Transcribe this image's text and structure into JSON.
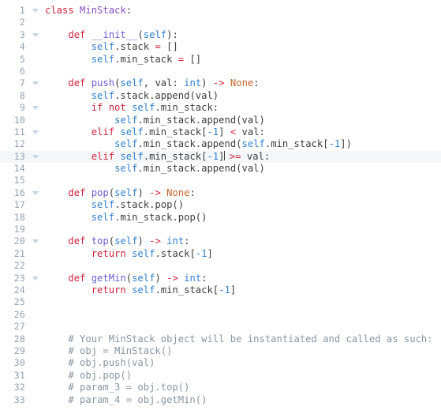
{
  "editor": {
    "language": "python",
    "current_line": 13,
    "colors": {
      "background": "#ffffff",
      "current_line_highlight": "#f4f7fa",
      "gutter_text": "#93a1b0",
      "fold_arrow": "#c3d4e2",
      "keyword": "#d0233c",
      "class_name": "#8a4fc4",
      "function_name": "#6a60d8",
      "self_builtin": "#2f7fd0",
      "none_literal": "#c4642a",
      "number": "#2f7fd0",
      "comment": "#8795a3",
      "plain_text": "#3c3c3c"
    },
    "lines": [
      {
        "number": "1",
        "fold": true,
        "tokens": [
          {
            "t": "class ",
            "c": "t-kw"
          },
          {
            "t": "MinStack",
            "c": "t-cls"
          },
          {
            "t": ":",
            "c": "t-punct"
          }
        ]
      },
      {
        "number": "2",
        "fold": false,
        "tokens": []
      },
      {
        "number": "3",
        "fold": true,
        "tokens": [
          {
            "t": "    ",
            "c": "t-plain"
          },
          {
            "t": "def ",
            "c": "t-def"
          },
          {
            "t": "__init__",
            "c": "t-fn"
          },
          {
            "t": "(",
            "c": "t-punct"
          },
          {
            "t": "self",
            "c": "t-self"
          },
          {
            "t": "):",
            "c": "t-punct"
          }
        ]
      },
      {
        "number": "4",
        "fold": false,
        "tokens": [
          {
            "t": "        ",
            "c": "t-plain"
          },
          {
            "t": "self",
            "c": "t-self"
          },
          {
            "t": ".stack ",
            "c": "t-plain"
          },
          {
            "t": "=",
            "c": "t-op"
          },
          {
            "t": " []",
            "c": "t-punct"
          }
        ]
      },
      {
        "number": "5",
        "fold": false,
        "tokens": [
          {
            "t": "        ",
            "c": "t-plain"
          },
          {
            "t": "self",
            "c": "t-self"
          },
          {
            "t": ".min_stack ",
            "c": "t-plain"
          },
          {
            "t": "=",
            "c": "t-op"
          },
          {
            "t": " []",
            "c": "t-punct"
          }
        ]
      },
      {
        "number": "6",
        "fold": false,
        "tokens": []
      },
      {
        "number": "7",
        "fold": true,
        "tokens": [
          {
            "t": "    ",
            "c": "t-plain"
          },
          {
            "t": "def ",
            "c": "t-def"
          },
          {
            "t": "push",
            "c": "t-fn"
          },
          {
            "t": "(",
            "c": "t-punct"
          },
          {
            "t": "self",
            "c": "t-self"
          },
          {
            "t": ", val: ",
            "c": "t-plain"
          },
          {
            "t": "int",
            "c": "t-builtin"
          },
          {
            "t": ") ",
            "c": "t-punct"
          },
          {
            "t": "->",
            "c": "t-op"
          },
          {
            "t": " ",
            "c": "t-plain"
          },
          {
            "t": "None",
            "c": "t-none"
          },
          {
            "t": ":",
            "c": "t-punct"
          }
        ]
      },
      {
        "number": "8",
        "fold": false,
        "tokens": [
          {
            "t": "        ",
            "c": "t-plain"
          },
          {
            "t": "self",
            "c": "t-self"
          },
          {
            "t": ".stack.append(val)",
            "c": "t-plain"
          }
        ]
      },
      {
        "number": "9",
        "fold": true,
        "tokens": [
          {
            "t": "        ",
            "c": "t-plain"
          },
          {
            "t": "if not ",
            "c": "t-kw"
          },
          {
            "t": "self",
            "c": "t-self"
          },
          {
            "t": ".min_stack:",
            "c": "t-plain"
          }
        ]
      },
      {
        "number": "10",
        "fold": false,
        "tokens": [
          {
            "t": "            ",
            "c": "t-plain"
          },
          {
            "t": "self",
            "c": "t-self"
          },
          {
            "t": ".min_stack.append(val)",
            "c": "t-plain"
          }
        ]
      },
      {
        "number": "11",
        "fold": true,
        "tokens": [
          {
            "t": "        ",
            "c": "t-plain"
          },
          {
            "t": "elif ",
            "c": "t-kw"
          },
          {
            "t": "self",
            "c": "t-self"
          },
          {
            "t": ".min_stack[",
            "c": "t-plain"
          },
          {
            "t": "-1",
            "c": "t-num"
          },
          {
            "t": "] ",
            "c": "t-plain"
          },
          {
            "t": "<",
            "c": "t-op"
          },
          {
            "t": " val:",
            "c": "t-plain"
          }
        ]
      },
      {
        "number": "12",
        "fold": false,
        "tokens": [
          {
            "t": "            ",
            "c": "t-plain"
          },
          {
            "t": "self",
            "c": "t-self"
          },
          {
            "t": ".min_stack.append(",
            "c": "t-plain"
          },
          {
            "t": "self",
            "c": "t-self"
          },
          {
            "t": ".min_stack[",
            "c": "t-plain"
          },
          {
            "t": "-1",
            "c": "t-num"
          },
          {
            "t": "])",
            "c": "t-plain"
          }
        ]
      },
      {
        "number": "13",
        "fold": true,
        "current": true,
        "tokens": [
          {
            "t": "        ",
            "c": "t-plain"
          },
          {
            "t": "elif ",
            "c": "t-kw"
          },
          {
            "t": "self",
            "c": "t-self"
          },
          {
            "t": ".min_stack[",
            "c": "t-plain"
          },
          {
            "t": "-1",
            "c": "t-num"
          },
          {
            "t": "]",
            "c": "t-plain"
          },
          {
            "t": "|CARET|",
            "c": "caret"
          },
          {
            "t": " ",
            "c": "t-plain"
          },
          {
            "t": ">=",
            "c": "t-op"
          },
          {
            "t": " val:",
            "c": "t-plain"
          }
        ]
      },
      {
        "number": "14",
        "fold": false,
        "tokens": [
          {
            "t": "            ",
            "c": "t-plain"
          },
          {
            "t": "self",
            "c": "t-self"
          },
          {
            "t": ".min_stack.append(val)",
            "c": "t-plain"
          }
        ]
      },
      {
        "number": "15",
        "fold": false,
        "tokens": []
      },
      {
        "number": "16",
        "fold": true,
        "tokens": [
          {
            "t": "    ",
            "c": "t-plain"
          },
          {
            "t": "def ",
            "c": "t-def"
          },
          {
            "t": "pop",
            "c": "t-fn"
          },
          {
            "t": "(",
            "c": "t-punct"
          },
          {
            "t": "self",
            "c": "t-self"
          },
          {
            "t": ") ",
            "c": "t-punct"
          },
          {
            "t": "->",
            "c": "t-op"
          },
          {
            "t": " ",
            "c": "t-plain"
          },
          {
            "t": "None",
            "c": "t-none"
          },
          {
            "t": ":",
            "c": "t-punct"
          }
        ]
      },
      {
        "number": "17",
        "fold": false,
        "tokens": [
          {
            "t": "        ",
            "c": "t-plain"
          },
          {
            "t": "self",
            "c": "t-self"
          },
          {
            "t": ".stack.pop()",
            "c": "t-plain"
          }
        ]
      },
      {
        "number": "18",
        "fold": false,
        "tokens": [
          {
            "t": "        ",
            "c": "t-plain"
          },
          {
            "t": "self",
            "c": "t-self"
          },
          {
            "t": ".min_stack.pop()",
            "c": "t-plain"
          }
        ]
      },
      {
        "number": "19",
        "fold": false,
        "tokens": []
      },
      {
        "number": "20",
        "fold": true,
        "tokens": [
          {
            "t": "    ",
            "c": "t-plain"
          },
          {
            "t": "def ",
            "c": "t-def"
          },
          {
            "t": "top",
            "c": "t-fn"
          },
          {
            "t": "(",
            "c": "t-punct"
          },
          {
            "t": "self",
            "c": "t-self"
          },
          {
            "t": ") ",
            "c": "t-punct"
          },
          {
            "t": "->",
            "c": "t-op"
          },
          {
            "t": " ",
            "c": "t-plain"
          },
          {
            "t": "int",
            "c": "t-builtin"
          },
          {
            "t": ":",
            "c": "t-punct"
          }
        ]
      },
      {
        "number": "21",
        "fold": false,
        "tokens": [
          {
            "t": "        ",
            "c": "t-plain"
          },
          {
            "t": "return ",
            "c": "t-kw"
          },
          {
            "t": "self",
            "c": "t-self"
          },
          {
            "t": ".stack[",
            "c": "t-plain"
          },
          {
            "t": "-1",
            "c": "t-num"
          },
          {
            "t": "]",
            "c": "t-plain"
          }
        ]
      },
      {
        "number": "22",
        "fold": false,
        "tokens": []
      },
      {
        "number": "23",
        "fold": true,
        "tokens": [
          {
            "t": "    ",
            "c": "t-plain"
          },
          {
            "t": "def ",
            "c": "t-def"
          },
          {
            "t": "getMin",
            "c": "t-fn"
          },
          {
            "t": "(",
            "c": "t-punct"
          },
          {
            "t": "self",
            "c": "t-self"
          },
          {
            "t": ") ",
            "c": "t-punct"
          },
          {
            "t": "->",
            "c": "t-op"
          },
          {
            "t": " ",
            "c": "t-plain"
          },
          {
            "t": "int",
            "c": "t-builtin"
          },
          {
            "t": ":",
            "c": "t-punct"
          }
        ]
      },
      {
        "number": "24",
        "fold": false,
        "tokens": [
          {
            "t": "        ",
            "c": "t-plain"
          },
          {
            "t": "return ",
            "c": "t-kw"
          },
          {
            "t": "self",
            "c": "t-self"
          },
          {
            "t": ".min_stack[",
            "c": "t-plain"
          },
          {
            "t": "-1",
            "c": "t-num"
          },
          {
            "t": "]",
            "c": "t-plain"
          }
        ]
      },
      {
        "number": "25",
        "fold": false,
        "tokens": []
      },
      {
        "number": "26",
        "fold": false,
        "tokens": []
      },
      {
        "number": "27",
        "fold": false,
        "tokens": []
      },
      {
        "number": "28",
        "fold": false,
        "tokens": [
          {
            "t": "    # Your MinStack object will be instantiated and called as such:",
            "c": "t-comment"
          }
        ]
      },
      {
        "number": "29",
        "fold": false,
        "tokens": [
          {
            "t": "    # obj = MinStack()",
            "c": "t-comment"
          }
        ]
      },
      {
        "number": "30",
        "fold": false,
        "tokens": [
          {
            "t": "    # obj.push(val)",
            "c": "t-comment"
          }
        ]
      },
      {
        "number": "31",
        "fold": false,
        "tokens": [
          {
            "t": "    # obj.pop()",
            "c": "t-comment"
          }
        ]
      },
      {
        "number": "32",
        "fold": false,
        "tokens": [
          {
            "t": "    # param_3 = obj.top()",
            "c": "t-comment"
          }
        ]
      },
      {
        "number": "33",
        "fold": false,
        "tokens": [
          {
            "t": "    # param_4 = obj.getMin()",
            "c": "t-comment"
          }
        ]
      }
    ]
  }
}
